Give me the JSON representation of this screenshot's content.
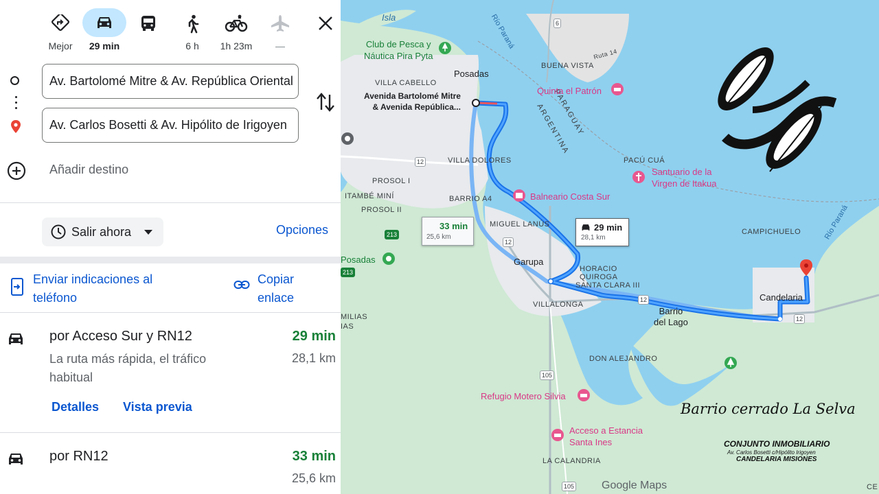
{
  "colors": {
    "accent": "#0b57d0",
    "green": "#188038",
    "route": "#1a73e8",
    "pin": "#ea4335",
    "poi": "#d93886"
  },
  "travel_modes": [
    {
      "name": "Mejor",
      "label": "Mejor",
      "icon": "best-route-icon",
      "active": false
    },
    {
      "name": "car",
      "label": "29 min",
      "icon": "car-icon",
      "active": true
    },
    {
      "name": "transit",
      "label": "",
      "icon": "bus-icon",
      "active": false
    },
    {
      "name": "walk",
      "label": "6 h",
      "icon": "walk-icon",
      "active": false
    },
    {
      "name": "bike",
      "label": "1h 23m",
      "icon": "bike-icon",
      "active": false
    },
    {
      "name": "flight",
      "label": "—",
      "icon": "plane-icon",
      "active": false
    }
  ],
  "origin": {
    "value": "Av. Bartolomé Mitre & Av. República Oriental"
  },
  "destination": {
    "value": "Av. Carlos Bosetti & Av. Hipólito de Irigoyen"
  },
  "add_destination": "Añadir destino",
  "depart": {
    "label": "Salir ahora"
  },
  "options_label": "Opciones",
  "share": {
    "send_label": "Enviar indicaciones al teléfono",
    "copy_label": "Copiar enlace"
  },
  "routes": [
    {
      "title": "por Acceso Sur y RN12",
      "time": "29 min",
      "distance": "28,1 km",
      "description": "La ruta más rápida, el tráfico habitual",
      "details_label": "Detalles",
      "preview_label": "Vista previa"
    },
    {
      "title": "por RN12",
      "time": "33 min",
      "distance": "25,6 km"
    }
  ],
  "map": {
    "places": {
      "posadas": "Posadas",
      "garupa": "Garupa",
      "barrio_lago": "Barrio\ndel Lago",
      "candelaria": "Candelaria",
      "posadas2": "Posadas"
    },
    "labels": {
      "villa_cabello": "VILLA CABELLO",
      "villa_dolores": "VILLA DOLORES",
      "prosol1": "PROSOL I",
      "itambe": "ITAMBÉ MINÍ",
      "prosol2": "PROSOL II",
      "barrio_a4": "BARRIO A4",
      "miguel_lanus": "MIGUEL LANÚS",
      "horacio": "HORACIO",
      "quiroga": "QUIROGA",
      "santa_clara": "SANTA CLARA III",
      "villalonga": "VILLALONGA",
      "don_alejandro": "DON ALEJANDRO",
      "la_calandria": "LA CALANDRIA",
      "buena_vista": "BUENA VISTA",
      "pacu_cua": "PACÚ CUÁ",
      "campichuelo": "CAMPICHUELO",
      "paraguay": "PARAGUAY",
      "argentina": "ARGENTINA",
      "milias": "MILIAS",
      "ias": "IAS",
      "ce": "CE",
      "ruta14": "Ruta 14"
    },
    "water": {
      "isla": "Isla",
      "rio1": "Río Paraná",
      "rio2": "Río Paraná"
    },
    "pois": {
      "club": "Club de Pesca y\nNáutica Pira Pyta",
      "quinta": "Quinta el Patrón",
      "santuario": "Santuario de la\nVirgen de Itakua",
      "balneario": "Balneario Costa Sur",
      "refugio": "Refugio Motero Silvia",
      "acceso": "Acceso a Estancia\nSanta Ines"
    },
    "origin_label": "Avenida Bartolomé Mitre\n& Avenida República...",
    "shields": {
      "s12a": "12",
      "s12b": "12",
      "s12c": "12",
      "s12d": "12",
      "s213a": "213",
      "s213b": "213",
      "s105a": "105",
      "s105b": "105",
      "s6": "6"
    },
    "callout_main": {
      "time": "29 min",
      "distance": "28,1 km"
    },
    "callout_alt": {
      "time": "33 min",
      "distance": "25,6 km"
    },
    "watermark": {
      "title": "Barrio cerrado La Selva",
      "line1": "CONJUNTO INMOBILIARIO",
      "line2": "Av. Carlos Bosetti c/Hipólito Irigoyen",
      "line3": "CANDELARIA MISIONES"
    },
    "logo": "Google Maps"
  }
}
